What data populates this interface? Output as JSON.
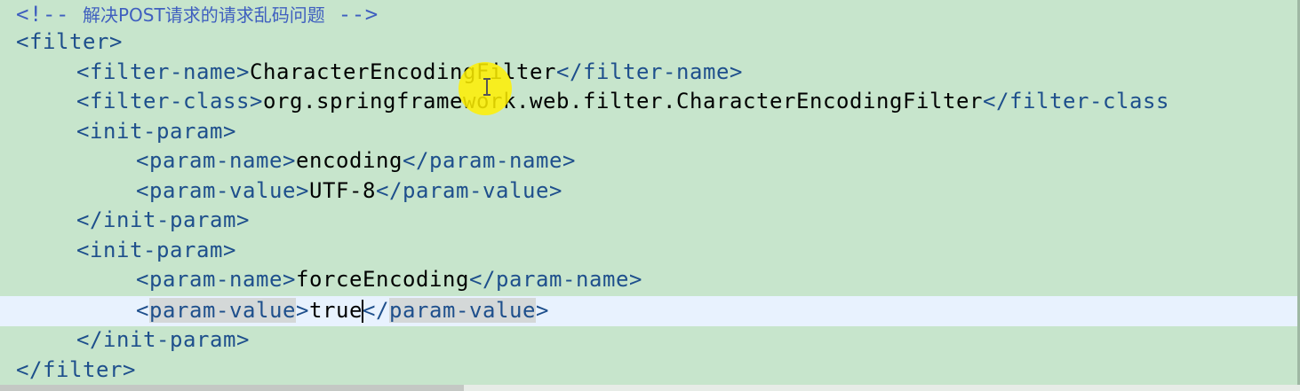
{
  "editor": {
    "lines": [
      {
        "comment_start": "<!-- ",
        "comment_text": "解决POST请求的请求乱码问题",
        "comment_end": " -->"
      },
      {
        "text": "<filter>"
      },
      {
        "open": "<filter-name>",
        "value": "CharacterEncodingFilter",
        "close": "</filter-name>"
      },
      {
        "open": "<filter-class>",
        "value": "org.springframework.web.filter.CharacterEncodingFilter",
        "close": "</filter-class"
      },
      {
        "text": "<init-param>"
      },
      {
        "open": "<param-name>",
        "value": "encoding",
        "close": "</param-name>"
      },
      {
        "open": "<param-value>",
        "value": "UTF-8",
        "close": "</param-value>"
      },
      {
        "text": "</init-param>"
      },
      {
        "text": "<init-param>"
      },
      {
        "open": "<param-name>",
        "value": "forceEncoding",
        "close": "</param-name>"
      },
      {
        "lt": "<",
        "open_name": "param-value",
        "gt": ">",
        "value": "true",
        "close_lt": "</",
        "close_name": "param-value",
        "close_gt": ">"
      },
      {
        "text": "</init-param>"
      },
      {
        "text": "</filter>"
      }
    ]
  },
  "colors": {
    "background": "#c7e5cc",
    "current_line": "#e8f2fe",
    "tag": "#1e4f8c",
    "comment": "#3f5fbf",
    "content": "#000000",
    "cursor_highlight": "#fff000"
  }
}
